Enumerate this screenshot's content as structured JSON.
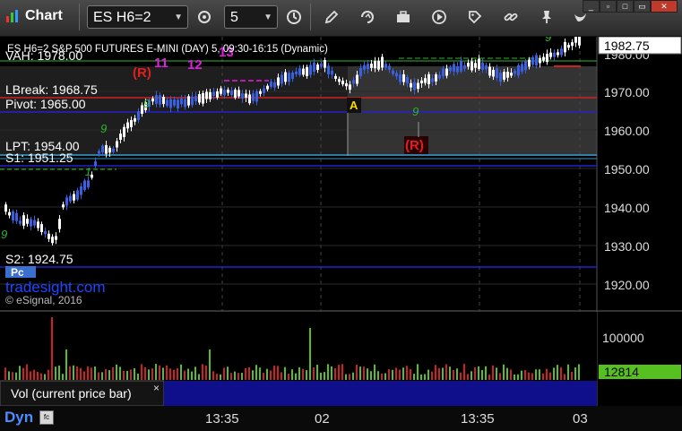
{
  "app": {
    "title": "Chart"
  },
  "toolbar": {
    "symbol": "ES H6=2",
    "interval": "5",
    "icons": [
      "pencil-icon",
      "cycle-icon",
      "toolbox-icon",
      "play-icon",
      "tag-icon",
      "pin-icon",
      "bird-icon"
    ]
  },
  "chart_header": {
    "symbol_line": "ES H6=2 S&P 500 FUTURES E-MINI (DAY) 5, 09:30-16:15 (Dynamic)"
  },
  "levels": {
    "vah": "VAH: 1978.00",
    "lbreak": "LBreak: 1968.75",
    "pivot": "Pivot: 1965.00",
    "lpt": "LPT: 1954.00",
    "s1": "S1: 1951.25",
    "s2": "S2: 1924.75"
  },
  "watermark": {
    "site": "tradesight.com",
    "copyright": "© eSignal, 2016"
  },
  "price_axis": {
    "ticks": [
      "1980.00",
      "1970.00",
      "1960.00",
      "1950.00",
      "1940.00",
      "1930.00",
      "1920.00"
    ],
    "current_price": "1982.75"
  },
  "volume_axis": {
    "tick": "100000",
    "current_volume": "12814"
  },
  "volume_panel": {
    "label": "Vol (current price bar)",
    "close": "×"
  },
  "time_axis": {
    "ticks": [
      "13:35",
      "02",
      "13:35",
      "03"
    ]
  },
  "markers": {
    "r1": "(R)",
    "r2": "(R)",
    "a": "A",
    "n11": "11",
    "n12": "12",
    "n13": "13",
    "d9a": "9",
    "d9b": "9",
    "d9c": "9",
    "d9d": "9",
    "d9e": "9",
    "pc": "Pc"
  },
  "status": {
    "mode": "Dyn"
  },
  "colors": {
    "up_bar": "#ffffff",
    "down_bar": "#3a5fe0",
    "blue_line": "#2222cc",
    "red_line": "#cc2222",
    "green_dash": "#2db82d",
    "magenta": "#e020e0",
    "vol_up": "#55c020",
    "vol_down": "#d02020",
    "panel_blue": "#0f0f8c"
  }
}
